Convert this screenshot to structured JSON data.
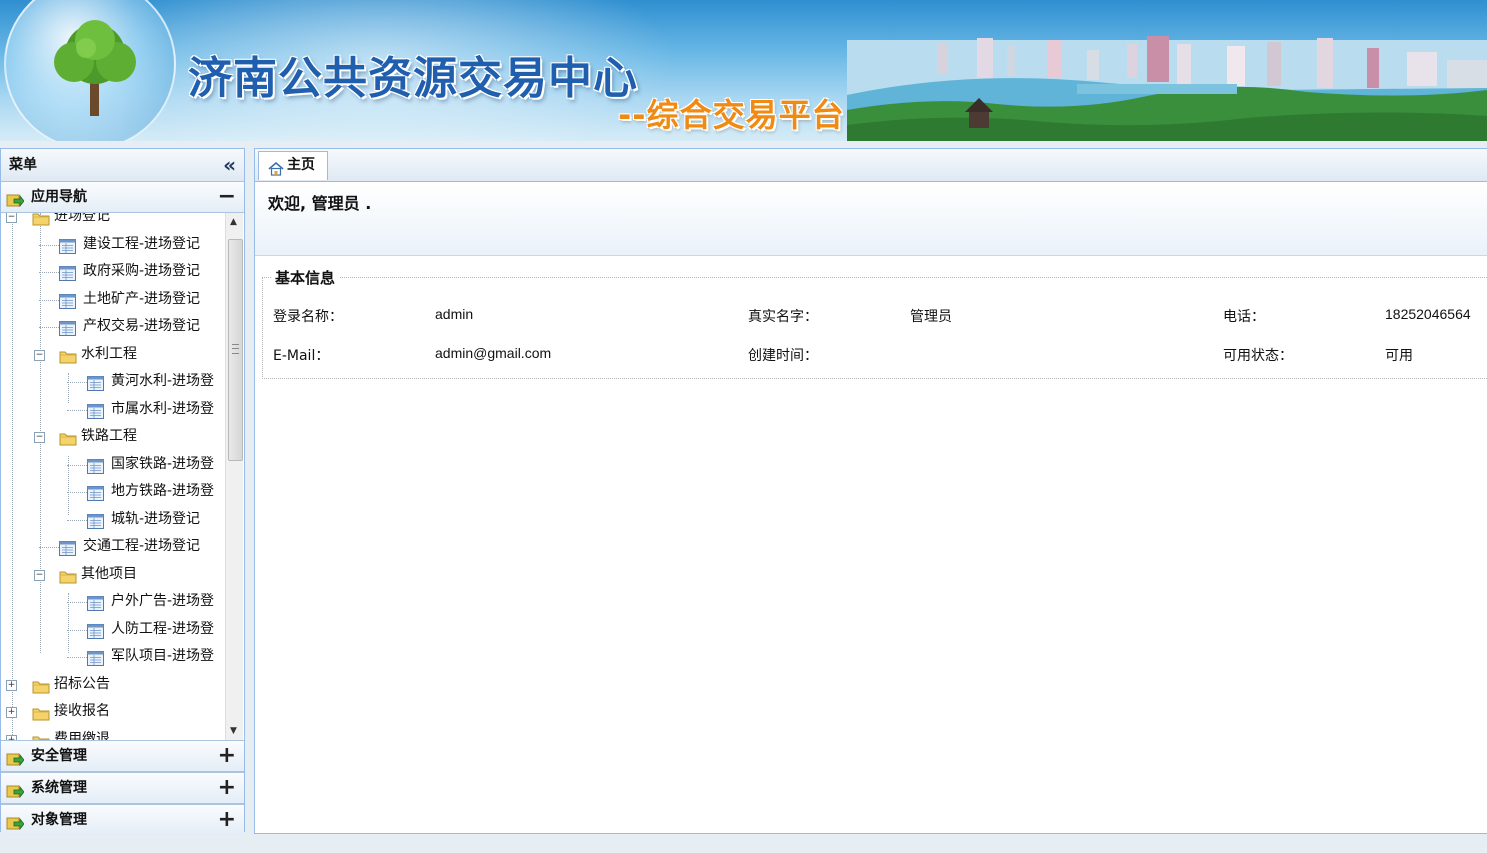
{
  "banner": {
    "title": "济南公共资源交易中心",
    "subtitle": "--综合交易平台"
  },
  "sidebar": {
    "title": "菜单",
    "active_section": {
      "label": "应用导航",
      "toggle": "−"
    },
    "tree": [
      {
        "label": "进场登记",
        "type": "folder",
        "level": 1,
        "expanded": true
      },
      {
        "label": "建设工程-进场登记",
        "type": "page",
        "level": 2
      },
      {
        "label": "政府采购-进场登记",
        "type": "page",
        "level": 2
      },
      {
        "label": "土地矿产-进场登记",
        "type": "page",
        "level": 2
      },
      {
        "label": "产权交易-进场登记",
        "type": "page",
        "level": 2
      },
      {
        "label": "水利工程",
        "type": "folder",
        "level": 2,
        "expanded": true
      },
      {
        "label": "黄河水利-进场登",
        "type": "page",
        "level": 3
      },
      {
        "label": "市属水利-进场登",
        "type": "page",
        "level": 3
      },
      {
        "label": "铁路工程",
        "type": "folder",
        "level": 2,
        "expanded": true
      },
      {
        "label": "国家铁路-进场登",
        "type": "page",
        "level": 3
      },
      {
        "label": "地方铁路-进场登",
        "type": "page",
        "level": 3
      },
      {
        "label": "城轨-进场登记",
        "type": "page",
        "level": 3
      },
      {
        "label": "交通工程-进场登记",
        "type": "page",
        "level": 2
      },
      {
        "label": "其他项目",
        "type": "folder",
        "level": 2,
        "expanded": true
      },
      {
        "label": "户外广告-进场登",
        "type": "page",
        "level": 3
      },
      {
        "label": "人防工程-进场登",
        "type": "page",
        "level": 3
      },
      {
        "label": "军队项目-进场登",
        "type": "page",
        "level": 3
      },
      {
        "label": "招标公告",
        "type": "folder",
        "level": 1,
        "expanded": false
      },
      {
        "label": "接收报名",
        "type": "folder",
        "level": 1,
        "expanded": false
      },
      {
        "label": "费用缴退",
        "type": "folder",
        "level": 1,
        "expanded": false
      }
    ],
    "sections": [
      {
        "label": "安全管理",
        "toggle": "+"
      },
      {
        "label": "系统管理",
        "toggle": "+"
      },
      {
        "label": "对象管理",
        "toggle": "+"
      }
    ]
  },
  "main": {
    "tab_label": "主页",
    "welcome": "欢迎, 管理员 .",
    "info_title": "基本信息",
    "fields": {
      "login_label": "登录名称：",
      "login_value": "admin",
      "realname_label": "真实名字：",
      "realname_value": "管理员",
      "phone_label": "电话：",
      "phone_value": "18252046564",
      "email_label": "E-Mail：",
      "email_value": "admin@gmail.com",
      "created_label": "创建时间：",
      "created_value": "",
      "status_label": "可用状态：",
      "status_value": "可用"
    }
  },
  "colors": {
    "panel_border": "#99bbe8",
    "title_blue": "#1f5fae",
    "subtitle_orange": "#f08a12"
  }
}
